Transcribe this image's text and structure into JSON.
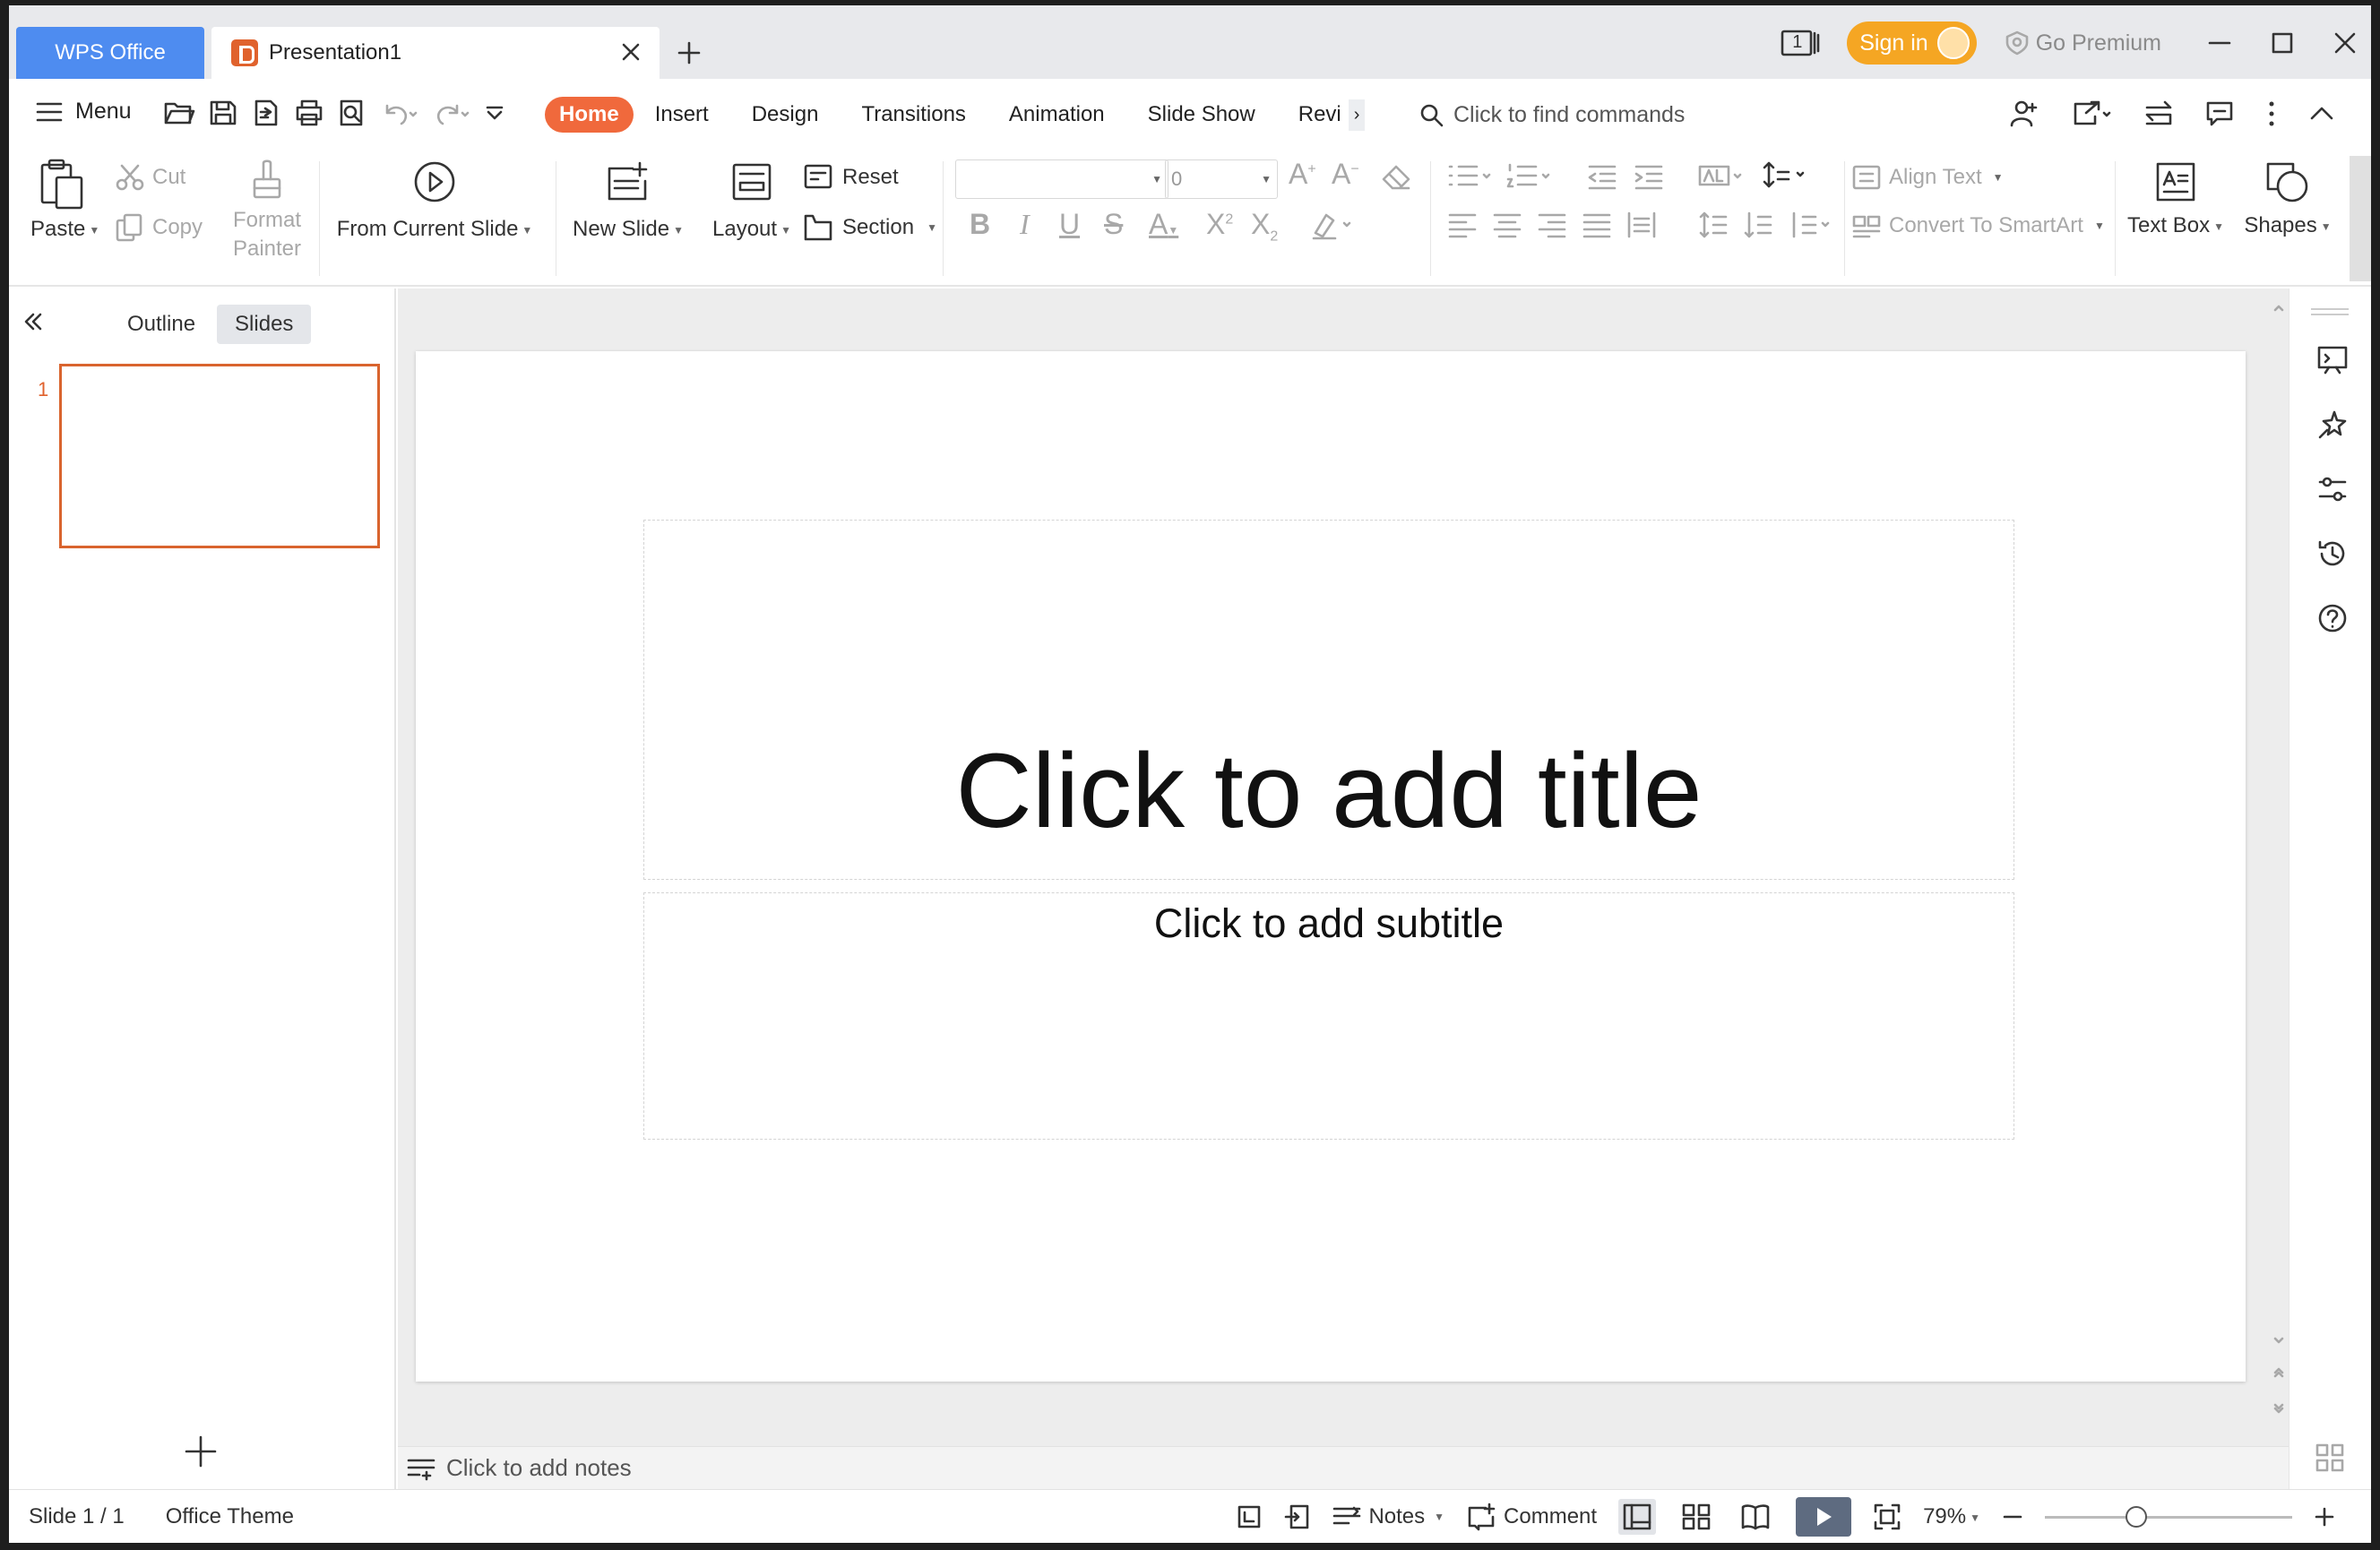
{
  "titlebar": {
    "app_tab": "WPS Office",
    "doc_tab": "Presentation1",
    "badge": "1",
    "sign_in": "Sign in",
    "go_premium": "Go Premium"
  },
  "menubar": {
    "menu_label": "Menu",
    "tabs": [
      "Home",
      "Insert",
      "Design",
      "Transitions",
      "Animation",
      "Slide Show",
      "Revi"
    ],
    "active_tab": "Home",
    "find_placeholder": "Click to find commands"
  },
  "ribbon": {
    "paste": "Paste",
    "cut": "Cut",
    "copy": "Copy",
    "format_painter_1": "Format",
    "format_painter_2": "Painter",
    "from_current_slide": "From Current Slide",
    "new_slide": "New Slide",
    "layout": "Layout",
    "reset": "Reset",
    "section": "Section",
    "font_name": "",
    "font_size": "0",
    "align_text": "Align Text",
    "convert_smartart": "Convert To SmartArt",
    "text_box": "Text Box",
    "shapes": "Shapes"
  },
  "leftpane": {
    "outline_tab": "Outline",
    "slides_tab": "Slides",
    "slide_number": "1"
  },
  "slide": {
    "title_placeholder": "Click to add title",
    "subtitle_placeholder": "Click to add subtitle"
  },
  "notes": {
    "placeholder": "Click to add notes"
  },
  "statusbar": {
    "slide_info": "Slide 1 / 1",
    "theme": "Office Theme",
    "notes": "Notes",
    "comment": "Comment",
    "zoom": "79%",
    "zoom_level": 0.37
  },
  "colors": {
    "accent_orange": "#f0693c",
    "wps_blue": "#4e8cf0",
    "sign_in": "#f5a623",
    "thumb_border": "#d9642e"
  }
}
